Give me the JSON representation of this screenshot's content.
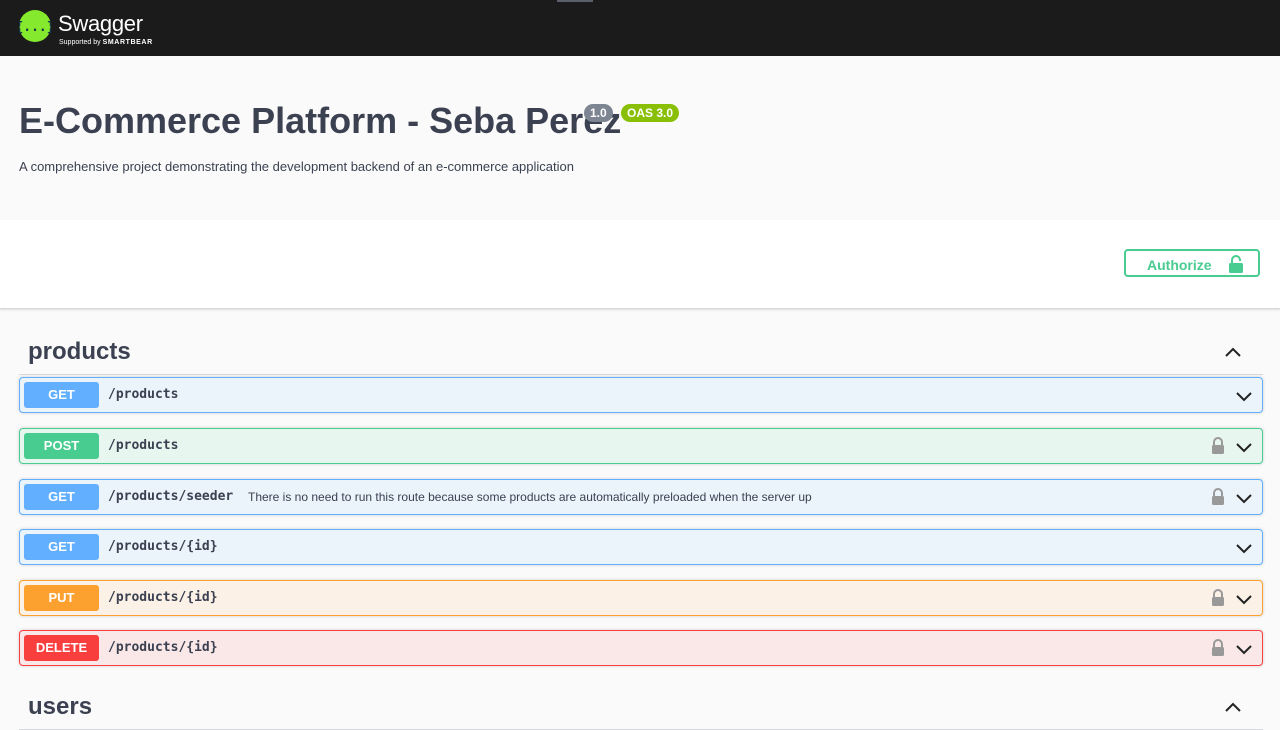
{
  "topbar": {
    "logo_text": "Swagger",
    "logo_supported_by": "Supported by",
    "logo_company": "SMARTBEAR",
    "logo_glyph": "{...}"
  },
  "info": {
    "title": "E-Commerce Platform - Seba Perez",
    "version_badge": "1.0",
    "oas_badge": "OAS 3.0",
    "description": "A comprehensive project demonstrating the development backend of an e-commerce application"
  },
  "authorize": {
    "label": "Authorize",
    "icon": "lock-open-icon"
  },
  "tags": [
    {
      "name": "products",
      "expanded": true,
      "operations": [
        {
          "method": "GET",
          "path": "/products",
          "summary": "",
          "locked": false
        },
        {
          "method": "POST",
          "path": "/products",
          "summary": "",
          "locked": true
        },
        {
          "method": "GET",
          "path": "/products/seeder",
          "summary": "There is no need to run this route because some products are automatically preloaded when the server up",
          "locked": true
        },
        {
          "method": "GET",
          "path": "/products/{id}",
          "summary": "",
          "locked": false
        },
        {
          "method": "PUT",
          "path": "/products/{id}",
          "summary": "",
          "locked": true
        },
        {
          "method": "DELETE",
          "path": "/products/{id}",
          "summary": "",
          "locked": true
        }
      ]
    },
    {
      "name": "users",
      "expanded": true,
      "operations": []
    }
  ],
  "colors": {
    "get": "#61affe",
    "post": "#49cc90",
    "put": "#fca130",
    "delete": "#f93e3e",
    "logo": "#85ea2d",
    "oas_badge": "#89bf04"
  }
}
